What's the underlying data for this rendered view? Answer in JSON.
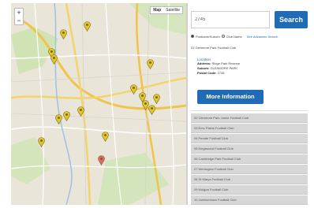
{
  "map": {
    "zoom_in": "+",
    "zoom_out": "−",
    "map_type": [
      "Map",
      "Satellite"
    ],
    "pins": [
      {
        "color": "#e2c62b"
      },
      {
        "color": "#e2c62b"
      },
      {
        "color": "#e2c62b"
      },
      {
        "color": "#e2c62b"
      },
      {
        "color": "#e2c62b"
      },
      {
        "color": "#e2c62b"
      },
      {
        "color": "#e2c62b"
      },
      {
        "color": "#e2c62b"
      },
      {
        "color": "#e2c62b"
      },
      {
        "color": "#e2c62b"
      },
      {
        "color": "#e2c62b"
      },
      {
        "color": "#e2c62b"
      },
      {
        "color": "#e2c62b"
      },
      {
        "color": "#e2c62b"
      },
      {
        "color": "#e2c62b"
      },
      {
        "color": "#e06a72"
      }
    ]
  },
  "sidebar": {
    "search_value": "2745",
    "search_button": "Search",
    "option_postcode": "Postcode/Suburb",
    "option_club": "Club Name",
    "advanced_link": "See Advanced Search",
    "result_title": "01 Glenmore Park Football Club",
    "location_heading": "Location",
    "address_label": "Address:",
    "address_value": "Ridge Park Reserve",
    "suburb_label": "Suburb:",
    "suburb_value": "GLENMORE PARK",
    "postcode_label": "Postal Code:",
    "postcode_value": "2745",
    "more_button": "More Information",
    "list_items": [
      "02 Glenmore Park Junior Football Club",
      "03 Emu Plains Football Club",
      "04 Penrith Football Club",
      "05 Kingswood Football Club",
      "06 Cambridge Park Football Club",
      "07 Werrington Football Club",
      "08 St Marys Football Club",
      "09 Mulgoa Football Club",
      "10 Jamisontown Football Club"
    ]
  }
}
